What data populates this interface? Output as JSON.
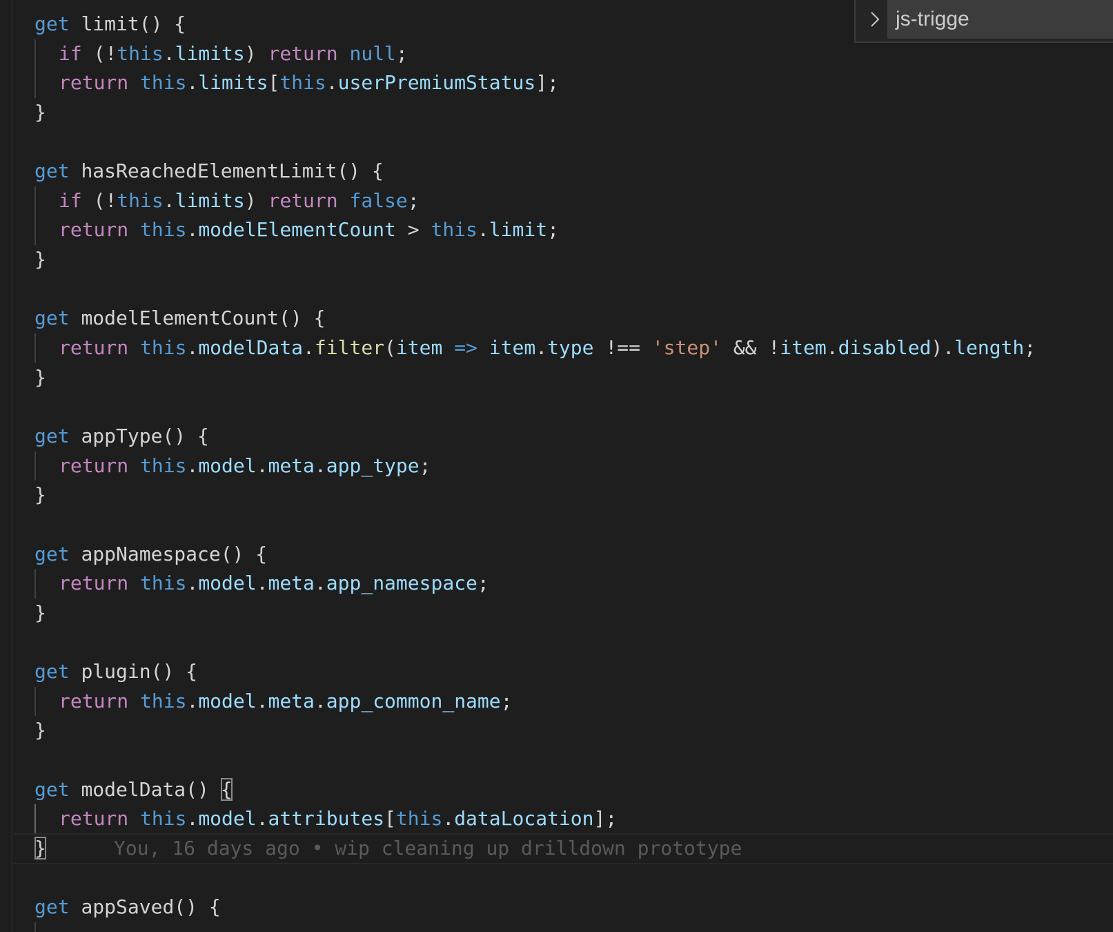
{
  "editor": {
    "code": {
      "getter_keyword": "get",
      "this_keyword": "this",
      "return_keyword": "return",
      "if_keyword": "if",
      "null_keyword": "null",
      "false_keyword": "false",
      "limit": {
        "name": "limit",
        "limits_prop": "limits",
        "user_premium_status": "userPremiumStatus"
      },
      "has_reached": {
        "name": "hasReachedElementLimit",
        "model_element_count": "modelElementCount",
        "limit_prop": "limit"
      },
      "model_element_count": {
        "name": "modelElementCount",
        "model_data": "modelData",
        "filter_fn": "filter",
        "item_param": "item",
        "type_prop": "type",
        "step_string": "'step'",
        "disabled_prop": "disabled",
        "length_prop": "length"
      },
      "app_type": {
        "name": "appType",
        "field": "app_type"
      },
      "app_namespace": {
        "name": "appNamespace",
        "field": "app_namespace"
      },
      "plugin": {
        "name": "plugin",
        "field": "app_common_name"
      },
      "model_data": {
        "name": "modelData",
        "attributes": "attributes",
        "data_location": "dataLocation"
      },
      "model_prop": "model",
      "meta_prop": "meta",
      "app_saved": {
        "name": "appSaved"
      }
    },
    "blame": "You, 16 days ago • wip cleaning up drilldown prototype",
    "colors": {
      "background": "#1e1e1e",
      "control_keyword": "#c586c0",
      "keyword": "#569cd6",
      "property": "#9cdcfe",
      "function": "#dcdcaa",
      "string": "#ce9178",
      "text": "#d4d4d4",
      "blame": "#5a5a5a"
    }
  },
  "breadcrumb": {
    "chevron_icon": "chevron-right-icon",
    "text": "js-trigge"
  }
}
